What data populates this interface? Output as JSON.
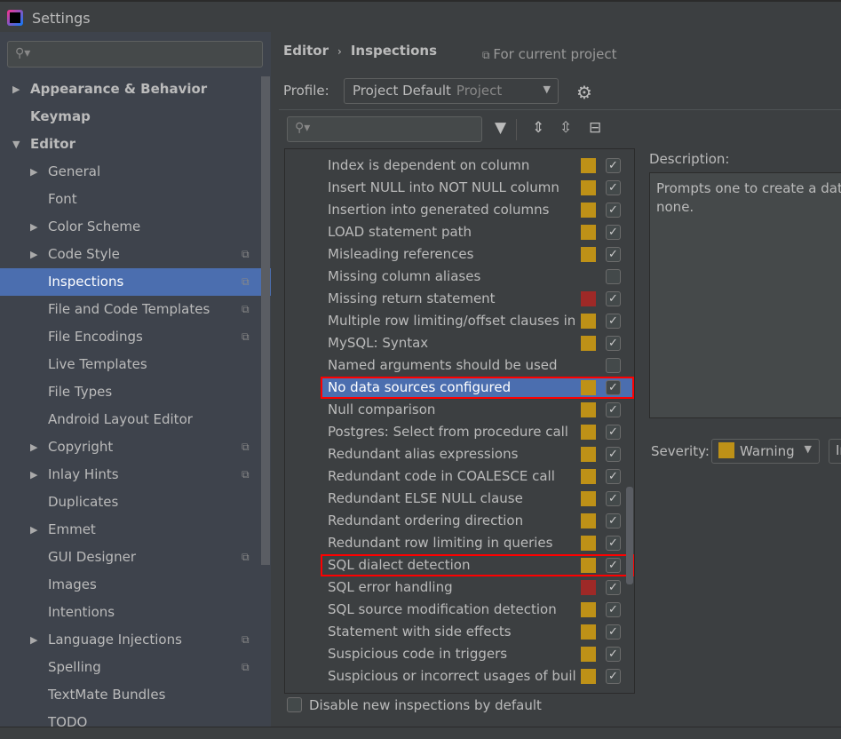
{
  "window": {
    "title": "Settings"
  },
  "sidebar": {
    "search_placeholder": "",
    "items": [
      {
        "label": "Appearance & Behavior",
        "level": 0,
        "arrow": "▶",
        "bold": true
      },
      {
        "label": "Keymap",
        "level": 0,
        "arrow": "",
        "bold": true
      },
      {
        "label": "Editor",
        "level": 0,
        "arrow": "▼",
        "bold": true
      },
      {
        "label": "General",
        "level": 1,
        "arrow": "▶"
      },
      {
        "label": "Font",
        "level": 1,
        "arrow": ""
      },
      {
        "label": "Color Scheme",
        "level": 1,
        "arrow": "▶"
      },
      {
        "label": "Code Style",
        "level": 1,
        "arrow": "▶",
        "copy": true
      },
      {
        "label": "Inspections",
        "level": 1,
        "arrow": "",
        "copy": true,
        "selected": true
      },
      {
        "label": "File and Code Templates",
        "level": 1,
        "arrow": "",
        "copy": true
      },
      {
        "label": "File Encodings",
        "level": 1,
        "arrow": "",
        "copy": true
      },
      {
        "label": "Live Templates",
        "level": 1,
        "arrow": ""
      },
      {
        "label": "File Types",
        "level": 1,
        "arrow": ""
      },
      {
        "label": "Android Layout Editor",
        "level": 1,
        "arrow": ""
      },
      {
        "label": "Copyright",
        "level": 1,
        "arrow": "▶",
        "copy": true
      },
      {
        "label": "Inlay Hints",
        "level": 1,
        "arrow": "▶",
        "copy": true
      },
      {
        "label": "Duplicates",
        "level": 1,
        "arrow": ""
      },
      {
        "label": "Emmet",
        "level": 1,
        "arrow": "▶"
      },
      {
        "label": "GUI Designer",
        "level": 1,
        "arrow": "",
        "copy": true
      },
      {
        "label": "Images",
        "level": 1,
        "arrow": ""
      },
      {
        "label": "Intentions",
        "level": 1,
        "arrow": ""
      },
      {
        "label": "Language Injections",
        "level": 1,
        "arrow": "▶",
        "copy": true
      },
      {
        "label": "Spelling",
        "level": 1,
        "arrow": "",
        "copy": true
      },
      {
        "label": "TextMate Bundles",
        "level": 1,
        "arrow": ""
      },
      {
        "label": "TODO",
        "level": 1,
        "arrow": ""
      }
    ]
  },
  "header": {
    "breadcrumb": [
      "Editor",
      "Inspections"
    ],
    "scope_note": "For current project",
    "profile_label": "Profile:",
    "profile_value": "Project Default",
    "profile_sub": "Project"
  },
  "colors": {
    "warning": "#be9117",
    "error": "#9e2927",
    "selection": "#4b6eaf",
    "highlight": "#ff0000"
  },
  "inspections": [
    {
      "name": "Index is dependent on column",
      "sev": "warning",
      "checked": true
    },
    {
      "name": "Insert NULL into NOT NULL column",
      "sev": "warning",
      "checked": true
    },
    {
      "name": "Insertion into generated columns",
      "sev": "warning",
      "checked": true
    },
    {
      "name": "LOAD statement path",
      "sev": "warning",
      "checked": true
    },
    {
      "name": "Misleading references",
      "sev": "warning",
      "checked": true
    },
    {
      "name": "Missing column aliases",
      "sev": "",
      "checked": false
    },
    {
      "name": "Missing return statement",
      "sev": "error",
      "checked": true
    },
    {
      "name": "Multiple row limiting/offset clauses in one query",
      "sev": "warning",
      "checked": true
    },
    {
      "name": "MySQL: Syntax",
      "sev": "warning",
      "checked": true
    },
    {
      "name": "Named arguments should be used",
      "sev": "",
      "checked": false
    },
    {
      "name": "No data sources configured",
      "sev": "warning",
      "checked": true,
      "selected": true,
      "highlighted": true
    },
    {
      "name": "Null comparison",
      "sev": "warning",
      "checked": true
    },
    {
      "name": "Postgres: Select from procedure call",
      "sev": "warning",
      "checked": true
    },
    {
      "name": "Redundant alias expressions",
      "sev": "warning",
      "checked": true
    },
    {
      "name": "Redundant code in COALESCE call",
      "sev": "warning",
      "checked": true
    },
    {
      "name": "Redundant ELSE NULL clause",
      "sev": "warning",
      "checked": true
    },
    {
      "name": "Redundant ordering direction",
      "sev": "warning",
      "checked": true
    },
    {
      "name": "Redundant row limiting in queries",
      "sev": "warning",
      "checked": true
    },
    {
      "name": "SQL dialect detection",
      "sev": "warning",
      "checked": true,
      "highlighted": true
    },
    {
      "name": "SQL error handling",
      "sev": "error",
      "checked": true
    },
    {
      "name": "SQL source modification detection",
      "sev": "warning",
      "checked": true
    },
    {
      "name": "Statement with side effects",
      "sev": "warning",
      "checked": true
    },
    {
      "name": "Suspicious code in triggers",
      "sev": "warning",
      "checked": true
    },
    {
      "name": "Suspicious or incorrect usages of built-in functions",
      "sev": "warning",
      "checked": true
    }
  ],
  "footer": {
    "disable_label": "Disable new inspections by default",
    "disable_checked": false
  },
  "description": {
    "label": "Description:",
    "text_line1": "Prompts one to create a data source if there is",
    "text_line2": "none."
  },
  "severity": {
    "label": "Severity:",
    "value": "Warning",
    "scope_value": "In"
  }
}
